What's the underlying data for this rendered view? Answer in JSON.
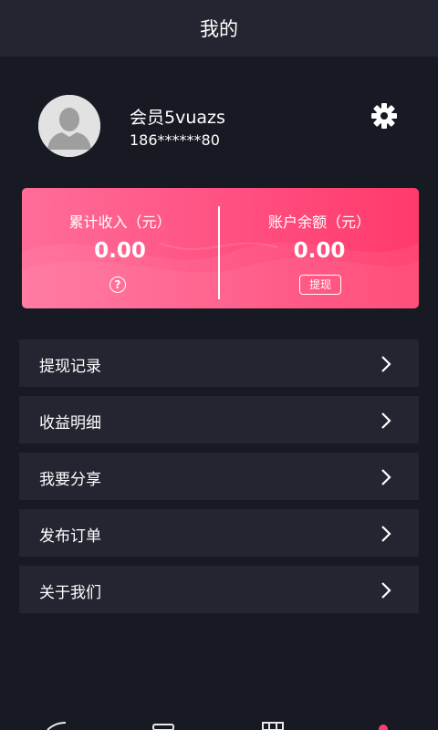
{
  "header": {
    "title": "我的"
  },
  "profile": {
    "username": "会员5vuazs",
    "phone": "186******80",
    "avatar_icon": "default-user-avatar-icon",
    "settings_icon": "gear-icon"
  },
  "earnings": {
    "total_income_label": "累计收入（元）",
    "total_income_value": "0.00",
    "help_symbol": "?",
    "balance_label": "账户余额（元）",
    "balance_value": "0.00",
    "withdraw_label": "提现",
    "gradient_colors": [
      "#ff6d99",
      "#ff4f80",
      "#ff3a6b"
    ]
  },
  "menu": {
    "items": [
      {
        "label": "提现记录"
      },
      {
        "label": "收益明细"
      },
      {
        "label": "我要分享"
      },
      {
        "label": "发布订单"
      },
      {
        "label": "关于我们"
      }
    ]
  },
  "colors": {
    "background": "#171a22",
    "panel": "#232631",
    "accent": "#ff4f80",
    "tab_active": "#ff3d6e"
  }
}
